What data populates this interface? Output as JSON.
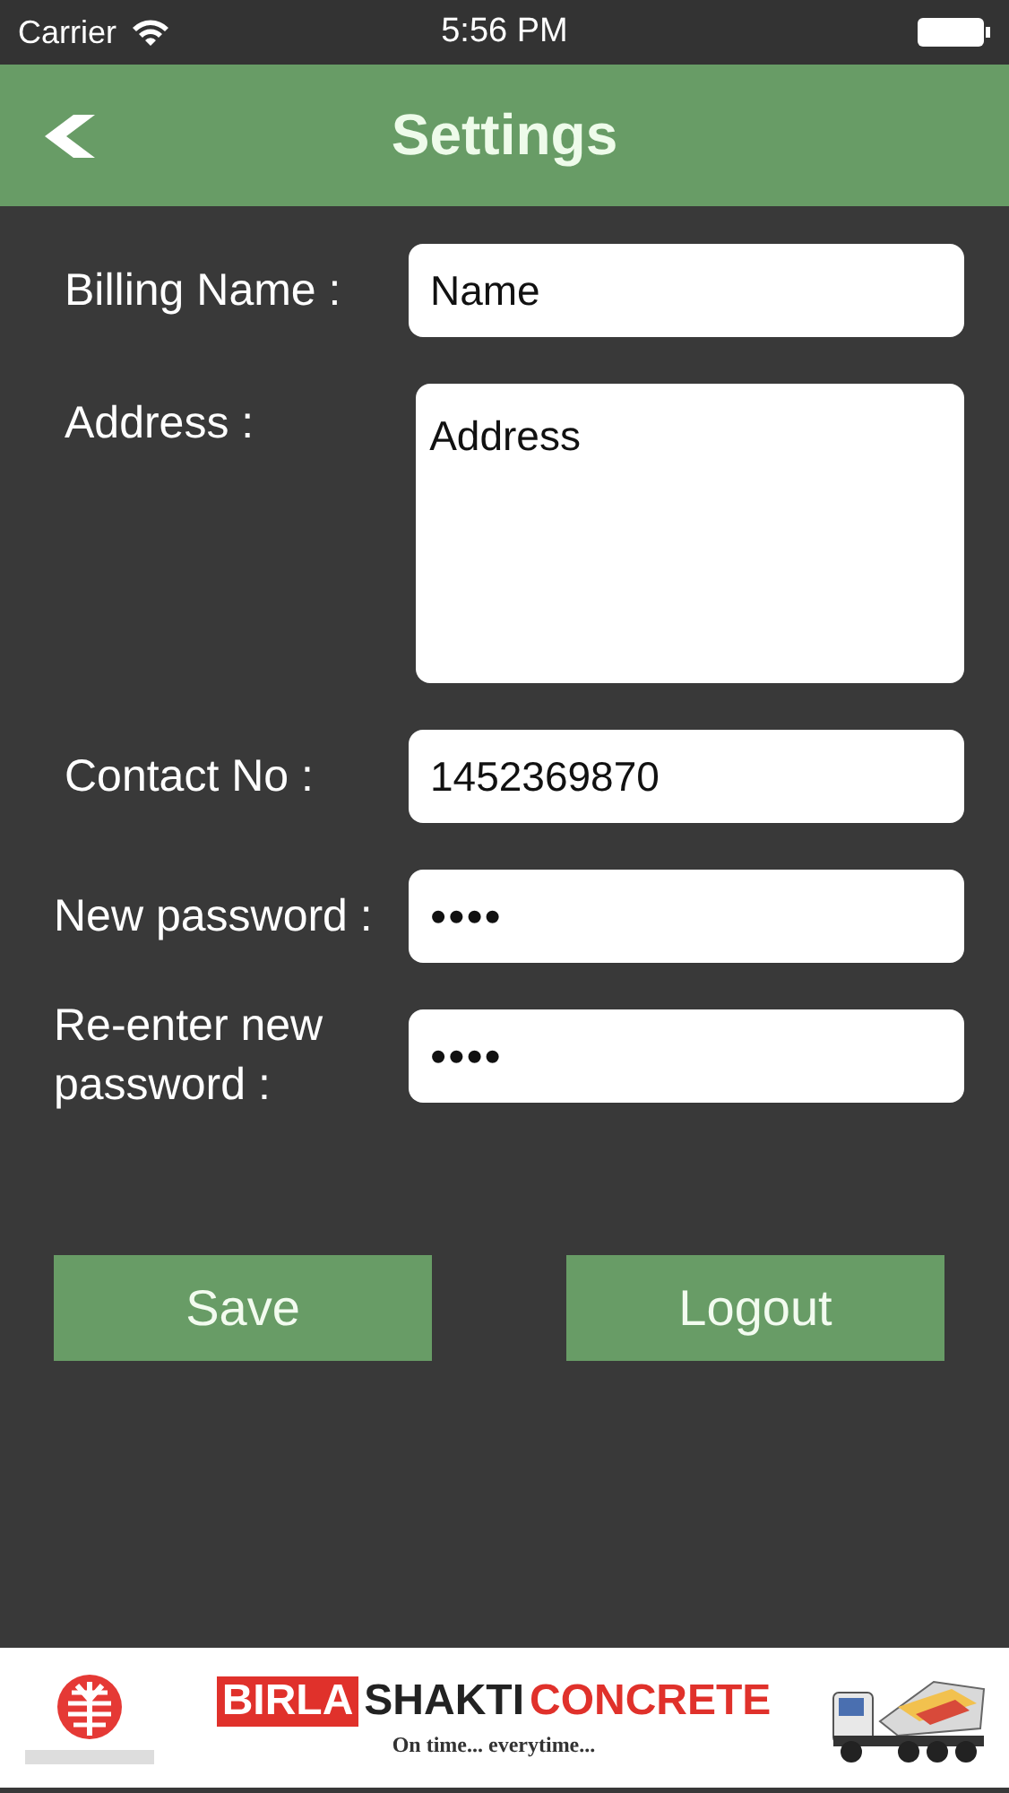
{
  "status_bar": {
    "carrier": "Carrier",
    "time": "5:56 PM"
  },
  "nav_bar": {
    "title": "Settings"
  },
  "form": [
    {
      "label": "Billing Name :",
      "kind": "text",
      "value": "Name"
    },
    {
      "label": "Address :",
      "kind": "textarea",
      "value": "Address"
    },
    {
      "label": "Contact No :",
      "kind": "text",
      "value": "1452369870"
    },
    {
      "label": "New password :",
      "kind": "password",
      "value": "••••"
    },
    {
      "label": "Re-enter new password :",
      "kind": "password",
      "value": "••••"
    }
  ],
  "buttons": [
    "Save",
    "Logout"
  ],
  "banner": {
    "brand": [
      "BIRLA",
      "SHAKTI",
      "CONCRETE"
    ],
    "tagline": "On time... everytime..."
  }
}
